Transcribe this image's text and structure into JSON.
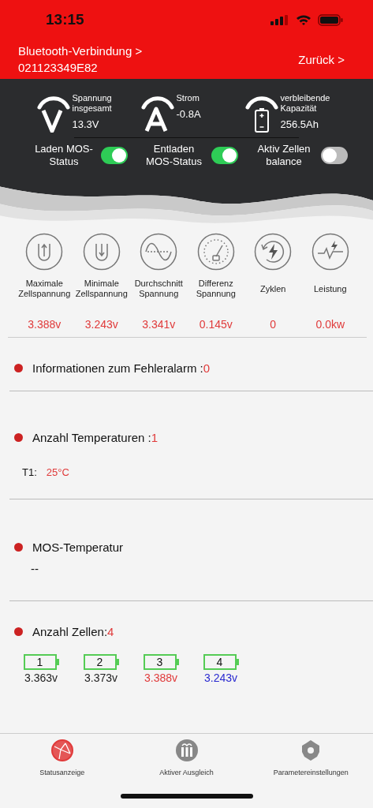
{
  "status_bar": {
    "time": "13:15"
  },
  "header": {
    "connection": "Bluetooth-Verbindung >",
    "device_id": "021123349E82",
    "back": "Zurück >"
  },
  "metrics": [
    {
      "kind": "voltage",
      "label": "Spannung insgesamt",
      "value": "13.3V"
    },
    {
      "kind": "current",
      "label": "Strom",
      "value": "-0.8A"
    },
    {
      "kind": "capacity",
      "label": "verbleibende Kapazität",
      "value": "256.5Ah"
    }
  ],
  "switches": [
    {
      "label": "Laden MOS-Status",
      "on": true
    },
    {
      "label": "Entladen MOS-Status",
      "on": true
    },
    {
      "label": "Aktiv Zellen balance",
      "on": false
    }
  ],
  "stats": [
    {
      "kind": "max",
      "label": "Maximale Zellspannung",
      "value": "3.388v"
    },
    {
      "kind": "min",
      "label": "Minimale Zellspannung",
      "value": "3.243v"
    },
    {
      "kind": "avg",
      "label": "Durchschnitt Spannung",
      "value": "3.341v"
    },
    {
      "kind": "diff",
      "label": "Differenz Spannung",
      "value": "0.145v"
    },
    {
      "kind": "cycles",
      "label": "Zyklen",
      "value": "0"
    },
    {
      "kind": "power",
      "label": "Leistung",
      "value": "0.0kw"
    }
  ],
  "alarm": {
    "label": "Informationen zum Fehleralarm :",
    "count": "0"
  },
  "temperatures": {
    "label": "Anzahl Temperaturen :",
    "count": "1",
    "items": [
      {
        "name": "T1:",
        "value": "25°C"
      }
    ]
  },
  "mos_temperature": {
    "label": "MOS-Temperatur",
    "value": "--"
  },
  "cells": {
    "label": "Anzahl Zellen:",
    "count": "4",
    "items": [
      {
        "number": "1",
        "voltage": "3.363v",
        "color": "#222222"
      },
      {
        "number": "2",
        "voltage": "3.373v",
        "color": "#222222"
      },
      {
        "number": "3",
        "voltage": "3.388v",
        "color": "#e03a3a"
      },
      {
        "number": "4",
        "voltage": "3.243v",
        "color": "#2a2ad0"
      }
    ]
  },
  "tabs": [
    {
      "kind": "status",
      "label": "Statusanzeige",
      "selected": true
    },
    {
      "kind": "balance",
      "label": "Aktiver Ausgleich",
      "selected": false
    },
    {
      "kind": "settings",
      "label": "Parametereinstellungen",
      "selected": false
    }
  ]
}
